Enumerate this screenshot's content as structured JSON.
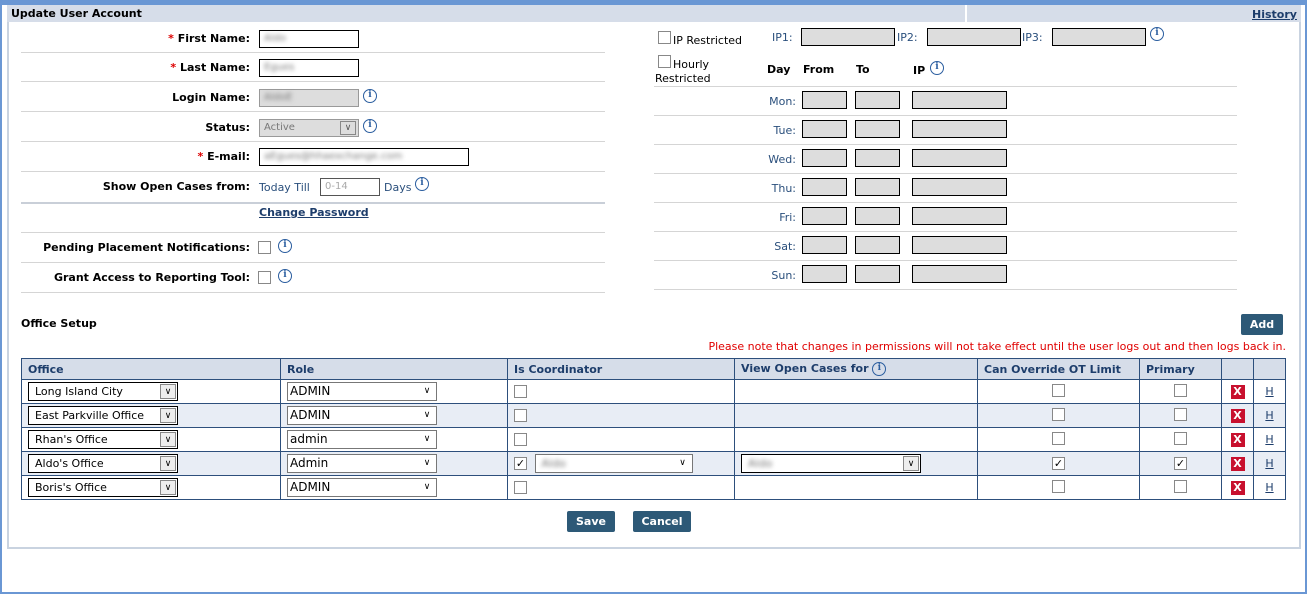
{
  "header": {
    "title": "Update User Account",
    "history": "History"
  },
  "form": {
    "first_name": {
      "label": "First Name:",
      "value": "Aldo"
    },
    "last_name": {
      "label": "Last Name:",
      "value": "Egues"
    },
    "login_name": {
      "label": "Login Name:",
      "value": "AldoE"
    },
    "status": {
      "label": "Status:",
      "value": "Active"
    },
    "email": {
      "label": "E-mail:",
      "value": "aEgues@hhaexchange.com"
    },
    "open_cases": {
      "label": "Show Open Cases from:",
      "prefix": "Today Till",
      "placeholder": "0-14",
      "suffix": "Days"
    },
    "change_password": "Change Password",
    "pending_notifications": {
      "label": "Pending Placement Notifications:",
      "checked": false
    },
    "reporting_tool": {
      "label": "Grant Access to Reporting Tool:",
      "checked": false
    },
    "required_mark": "*"
  },
  "restrictions": {
    "ip_restricted": "IP Restricted",
    "ip1": "IP1:",
    "ip2": "IP2:",
    "ip3": "IP3:",
    "hourly_restricted_1": "Hourly",
    "hourly_restricted_2": "Restricted",
    "col_day": "Day",
    "col_from": "From",
    "col_to": "To",
    "col_ip": "IP",
    "days": [
      "Mon:",
      "Tue:",
      "Wed:",
      "Thu:",
      "Fri:",
      "Sat:",
      "Sun:"
    ]
  },
  "office_setup": {
    "title": "Office Setup",
    "add": "Add",
    "notice": "Please note that changes in permissions will not take effect until the user logs out and then logs back in.",
    "columns": [
      "Office",
      "Role",
      "Is Coordinator",
      "View Open Cases for",
      "Can Override OT Limit",
      "Primary"
    ],
    "rows": [
      {
        "office": "Long Island City",
        "role": "ADMIN",
        "coordinator": false,
        "coordinator_name": "",
        "view_for": "",
        "override": false,
        "primary": false
      },
      {
        "office": "East Parkville Office",
        "role": "ADMIN",
        "coordinator": false,
        "coordinator_name": "",
        "view_for": "",
        "override": false,
        "primary": false
      },
      {
        "office": "Rhan's Office",
        "role": "admin",
        "coordinator": false,
        "coordinator_name": "",
        "view_for": "",
        "override": false,
        "primary": false
      },
      {
        "office": "Aldo's Office",
        "role": "Admin",
        "coordinator": true,
        "coordinator_name": "Aldo",
        "view_for": "Aldo",
        "override": true,
        "primary": true
      },
      {
        "office": "Boris's Office",
        "role": "ADMIN",
        "coordinator": false,
        "coordinator_name": "",
        "view_for": "",
        "override": false,
        "primary": false
      }
    ],
    "delete_label": "X",
    "history_label": "H"
  },
  "actions": {
    "save": "Save",
    "cancel": "Cancel"
  },
  "colors": {
    "header_bg": "#d6dde9",
    "button": "#2d5977",
    "notice": "#e00000",
    "delete": "#c8102e",
    "frame": "#6a97d4"
  }
}
